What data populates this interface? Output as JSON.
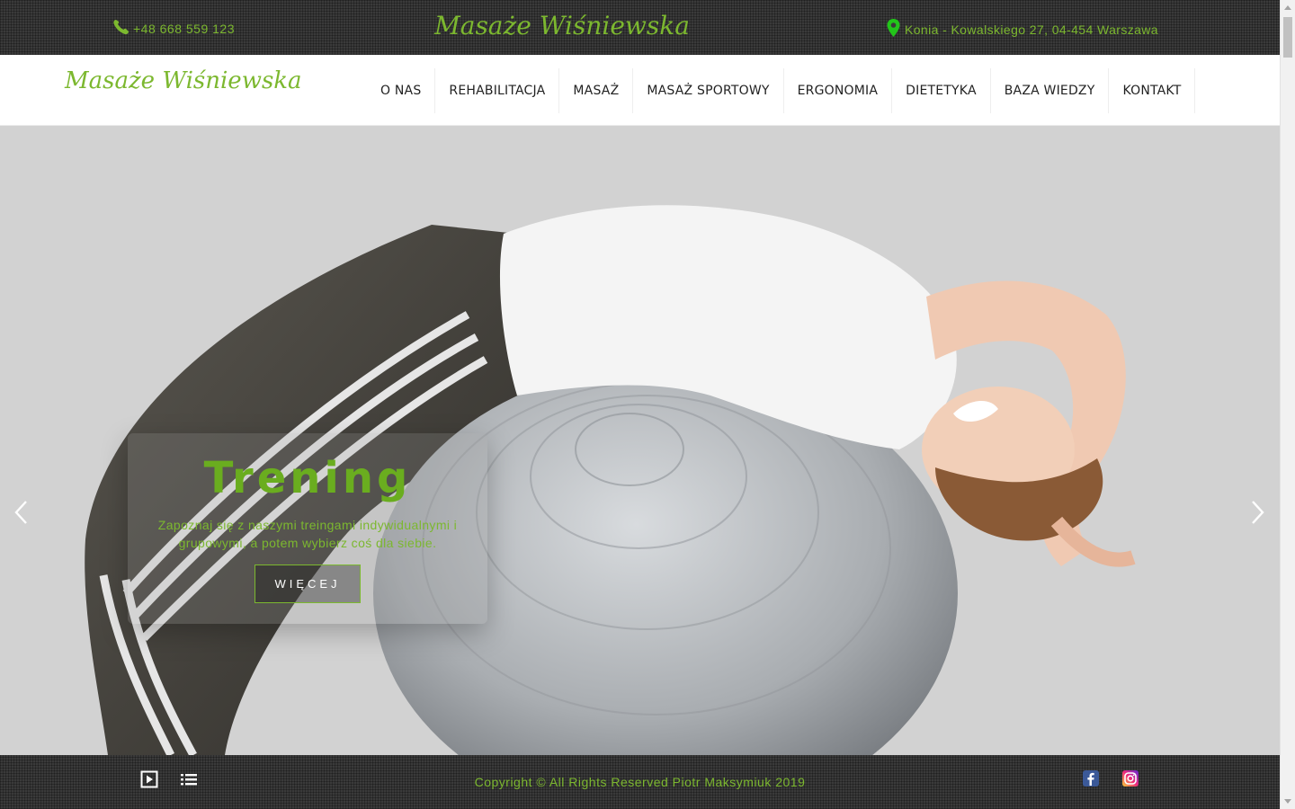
{
  "colors": {
    "accent": "#7cb82f",
    "topbar": "#3a3a3a",
    "hero_bg": "#d2d2d2"
  },
  "topbar": {
    "phone": "+48 668 559 123",
    "phone_icon": "phone-icon",
    "brand": "Masaże Wiśniewska",
    "address": "Konia - Kowalskiego 27, 04-454 Warszawa",
    "address_icon": "map-pin-icon"
  },
  "nav": {
    "logo": "Masaże Wiśniewska",
    "items": [
      {
        "label": "O NAS"
      },
      {
        "label": "REHABILITACJA"
      },
      {
        "label": "MASAŻ"
      },
      {
        "label": "MASAŻ SPORTOWY"
      },
      {
        "label": "ERGONOMIA"
      },
      {
        "label": "DIETETYKA"
      },
      {
        "label": "BAZA WIEDZY"
      },
      {
        "label": "KONTAKT"
      }
    ]
  },
  "slider": {
    "title": "Trening",
    "text": "Zapoznaj się z naszymi treingami indywidualnymi i grupowymi, a potem wybierz coś dla siebie.",
    "button": "WIĘCEJ",
    "prev_icon": "chevron-left-icon",
    "next_icon": "chevron-right-icon"
  },
  "footer": {
    "copyright": "Copyright © All Rights Reserved Piotr Maksymiuk 2019",
    "controls": [
      "play-icon",
      "list-icon"
    ],
    "social": [
      "facebook-icon",
      "instagram-icon"
    ]
  }
}
